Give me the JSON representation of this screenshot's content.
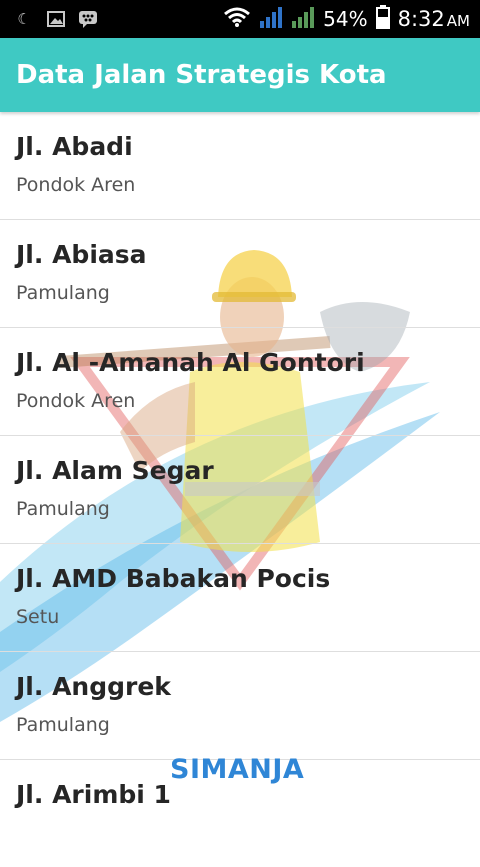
{
  "status_bar": {
    "icons_left": [
      "moon-icon",
      "image-icon",
      "bbm-icon"
    ],
    "icons_right": [
      "wifi-icon",
      "signal-icon",
      "signal-icon-2",
      "battery-icon"
    ],
    "battery": "54%",
    "time": "8:32",
    "ampm": "AM"
  },
  "toolbar": {
    "title": "Data Jalan Strategis Kota"
  },
  "list": {
    "items": [
      {
        "name": "Jl. Abadi",
        "area": "Pondok Aren"
      },
      {
        "name": "Jl. Abiasa",
        "area": "Pamulang"
      },
      {
        "name": "Jl. Al -Amanah Al Gontori",
        "area": "Pondok Aren"
      },
      {
        "name": "Jl. Alam Segar",
        "area": "Pamulang"
      },
      {
        "name": "Jl. AMD Babakan Pocis",
        "area": "Setu"
      },
      {
        "name": "Jl. Anggrek",
        "area": "Pamulang"
      },
      {
        "name": "Jl. Arimbi 1",
        "area": ""
      }
    ]
  },
  "watermark": {
    "brand": "SIMANJA"
  },
  "colors": {
    "toolbar": "#3fc9c3",
    "brand": "#2f86d6"
  }
}
